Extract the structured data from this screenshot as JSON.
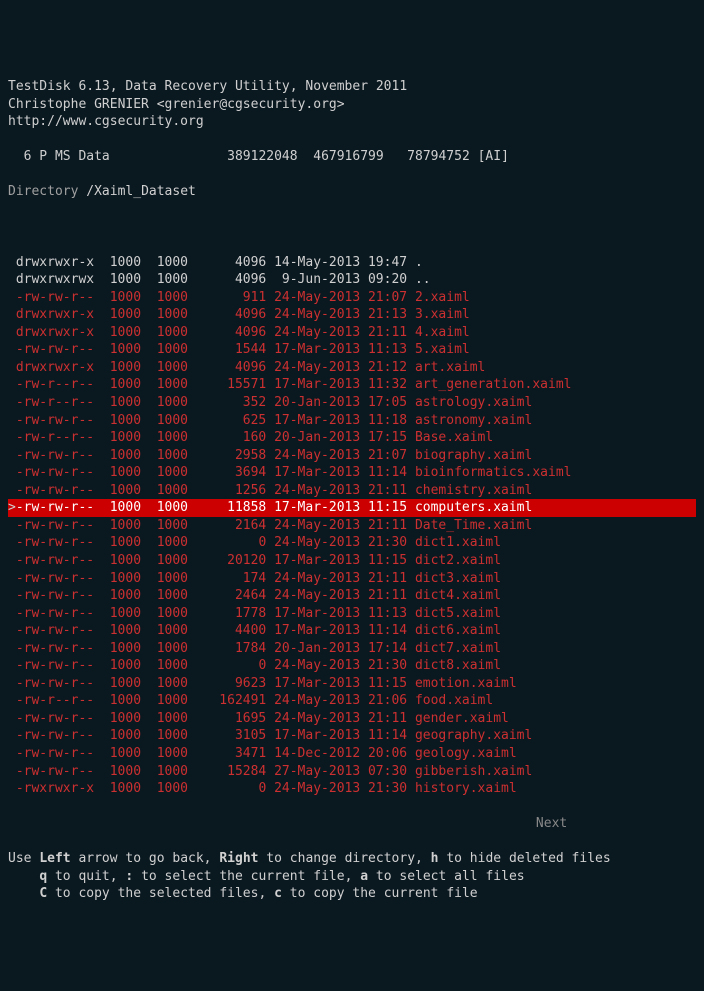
{
  "header": {
    "line1": "TestDisk 6.13, Data Recovery Utility, November 2011",
    "line2": "Christophe GRENIER <grenier@cgsecurity.org>",
    "line3": "http://www.cgsecurity.org"
  },
  "partition": "  6 P MS Data               389122048  467916799   78794752 [AI]",
  "directory_label": "Directory ",
  "directory_path": "/Xaiml_Dataset",
  "rows": [
    {
      "perms": "drwxrwxr-x",
      "uid": "1000",
      "gid": "1000",
      "size": "4096",
      "date": "14-May-2013",
      "time": "19:47",
      "name": ".",
      "deleted": false,
      "selected": false
    },
    {
      "perms": "drwxrwxrwx",
      "uid": "1000",
      "gid": "1000",
      "size": "4096",
      "date": " 9-Jun-2013",
      "time": "09:20",
      "name": "..",
      "deleted": false,
      "selected": false
    },
    {
      "perms": "-rw-rw-r--",
      "uid": "1000",
      "gid": "1000",
      "size": "911",
      "date": "24-May-2013",
      "time": "21:07",
      "name": "2.xaiml",
      "deleted": true,
      "selected": false
    },
    {
      "perms": "drwxrwxr-x",
      "uid": "1000",
      "gid": "1000",
      "size": "4096",
      "date": "24-May-2013",
      "time": "21:13",
      "name": "3.xaiml",
      "deleted": true,
      "selected": false
    },
    {
      "perms": "drwxrwxr-x",
      "uid": "1000",
      "gid": "1000",
      "size": "4096",
      "date": "24-May-2013",
      "time": "21:11",
      "name": "4.xaiml",
      "deleted": true,
      "selected": false
    },
    {
      "perms": "-rw-rw-r--",
      "uid": "1000",
      "gid": "1000",
      "size": "1544",
      "date": "17-Mar-2013",
      "time": "11:13",
      "name": "5.xaiml",
      "deleted": true,
      "selected": false
    },
    {
      "perms": "drwxrwxr-x",
      "uid": "1000",
      "gid": "1000",
      "size": "4096",
      "date": "24-May-2013",
      "time": "21:12",
      "name": "art.xaiml",
      "deleted": true,
      "selected": false
    },
    {
      "perms": "-rw-r--r--",
      "uid": "1000",
      "gid": "1000",
      "size": "15571",
      "date": "17-Mar-2013",
      "time": "11:32",
      "name": "art_generation.xaiml",
      "deleted": true,
      "selected": false
    },
    {
      "perms": "-rw-r--r--",
      "uid": "1000",
      "gid": "1000",
      "size": "352",
      "date": "20-Jan-2013",
      "time": "17:05",
      "name": "astrology.xaiml",
      "deleted": true,
      "selected": false
    },
    {
      "perms": "-rw-rw-r--",
      "uid": "1000",
      "gid": "1000",
      "size": "625",
      "date": "17-Mar-2013",
      "time": "11:18",
      "name": "astronomy.xaiml",
      "deleted": true,
      "selected": false
    },
    {
      "perms": "-rw-r--r--",
      "uid": "1000",
      "gid": "1000",
      "size": "160",
      "date": "20-Jan-2013",
      "time": "17:15",
      "name": "Base.xaiml",
      "deleted": true,
      "selected": false
    },
    {
      "perms": "-rw-rw-r--",
      "uid": "1000",
      "gid": "1000",
      "size": "2958",
      "date": "24-May-2013",
      "time": "21:07",
      "name": "biography.xaiml",
      "deleted": true,
      "selected": false
    },
    {
      "perms": "-rw-rw-r--",
      "uid": "1000",
      "gid": "1000",
      "size": "3694",
      "date": "17-Mar-2013",
      "time": "11:14",
      "name": "bioinformatics.xaiml",
      "deleted": true,
      "selected": false
    },
    {
      "perms": "-rw-rw-r--",
      "uid": "1000",
      "gid": "1000",
      "size": "1256",
      "date": "24-May-2013",
      "time": "21:11",
      "name": "chemistry.xaiml",
      "deleted": true,
      "selected": false
    },
    {
      "perms": "-rw-rw-r--",
      "uid": "1000",
      "gid": "1000",
      "size": "11858",
      "date": "17-Mar-2013",
      "time": "11:15",
      "name": "computers.xaiml",
      "deleted": true,
      "selected": true
    },
    {
      "perms": "-rw-rw-r--",
      "uid": "1000",
      "gid": "1000",
      "size": "2164",
      "date": "24-May-2013",
      "time": "21:11",
      "name": "Date_Time.xaiml",
      "deleted": true,
      "selected": false
    },
    {
      "perms": "-rw-rw-r--",
      "uid": "1000",
      "gid": "1000",
      "size": "0",
      "date": "24-May-2013",
      "time": "21:30",
      "name": "dict1.xaiml",
      "deleted": true,
      "selected": false
    },
    {
      "perms": "-rw-rw-r--",
      "uid": "1000",
      "gid": "1000",
      "size": "20120",
      "date": "17-Mar-2013",
      "time": "11:15",
      "name": "dict2.xaiml",
      "deleted": true,
      "selected": false
    },
    {
      "perms": "-rw-rw-r--",
      "uid": "1000",
      "gid": "1000",
      "size": "174",
      "date": "24-May-2013",
      "time": "21:11",
      "name": "dict3.xaiml",
      "deleted": true,
      "selected": false
    },
    {
      "perms": "-rw-rw-r--",
      "uid": "1000",
      "gid": "1000",
      "size": "2464",
      "date": "24-May-2013",
      "time": "21:11",
      "name": "dict4.xaiml",
      "deleted": true,
      "selected": false
    },
    {
      "perms": "-rw-rw-r--",
      "uid": "1000",
      "gid": "1000",
      "size": "1778",
      "date": "17-Mar-2013",
      "time": "11:13",
      "name": "dict5.xaiml",
      "deleted": true,
      "selected": false
    },
    {
      "perms": "-rw-rw-r--",
      "uid": "1000",
      "gid": "1000",
      "size": "4400",
      "date": "17-Mar-2013",
      "time": "11:14",
      "name": "dict6.xaiml",
      "deleted": true,
      "selected": false
    },
    {
      "perms": "-rw-rw-r--",
      "uid": "1000",
      "gid": "1000",
      "size": "1784",
      "date": "20-Jan-2013",
      "time": "17:14",
      "name": "dict7.xaiml",
      "deleted": true,
      "selected": false
    },
    {
      "perms": "-rw-rw-r--",
      "uid": "1000",
      "gid": "1000",
      "size": "0",
      "date": "24-May-2013",
      "time": "21:30",
      "name": "dict8.xaiml",
      "deleted": true,
      "selected": false
    },
    {
      "perms": "-rw-rw-r--",
      "uid": "1000",
      "gid": "1000",
      "size": "9623",
      "date": "17-Mar-2013",
      "time": "11:15",
      "name": "emotion.xaiml",
      "deleted": true,
      "selected": false
    },
    {
      "perms": "-rw-r--r--",
      "uid": "1000",
      "gid": "1000",
      "size": "162491",
      "date": "24-May-2013",
      "time": "21:06",
      "name": "food.xaiml",
      "deleted": true,
      "selected": false
    },
    {
      "perms": "-rw-rw-r--",
      "uid": "1000",
      "gid": "1000",
      "size": "1695",
      "date": "24-May-2013",
      "time": "21:11",
      "name": "gender.xaiml",
      "deleted": true,
      "selected": false
    },
    {
      "perms": "-rw-rw-r--",
      "uid": "1000",
      "gid": "1000",
      "size": "3105",
      "date": "17-Mar-2013",
      "time": "11:14",
      "name": "geography.xaiml",
      "deleted": true,
      "selected": false
    },
    {
      "perms": "-rw-rw-r--",
      "uid": "1000",
      "gid": "1000",
      "size": "3471",
      "date": "14-Dec-2012",
      "time": "20:06",
      "name": "geology.xaiml",
      "deleted": true,
      "selected": false
    },
    {
      "perms": "-rw-rw-r--",
      "uid": "1000",
      "gid": "1000",
      "size": "15284",
      "date": "27-May-2013",
      "time": "07:30",
      "name": "gibberish.xaiml",
      "deleted": true,
      "selected": false
    },
    {
      "perms": "-rwxrwxr-x",
      "uid": "1000",
      "gid": "1000",
      "size": "0",
      "date": "24-May-2013",
      "time": "21:30",
      "name": "history.xaiml",
      "deleted": true,
      "selected": false
    }
  ],
  "cursor": ">",
  "next_label": "Next",
  "help": {
    "line1_pre": "Use ",
    "left": "Left",
    "line1_mid1": " arrow to go back, ",
    "right": "Right",
    "line1_mid2": " to change directory, ",
    "h": "h",
    "line1_end": " to hide deleted files",
    "line2_pre": "    ",
    "q": "q",
    "line2_mid1": " to quit, ",
    "colon": ":",
    "line2_mid2": " to select the current file, ",
    "a": "a",
    "line2_end": " to select all files",
    "line3_pre": "    ",
    "C": "C",
    "line3_mid1": " to copy the selected files, ",
    "c": "c",
    "line3_end": " to copy the current file"
  }
}
